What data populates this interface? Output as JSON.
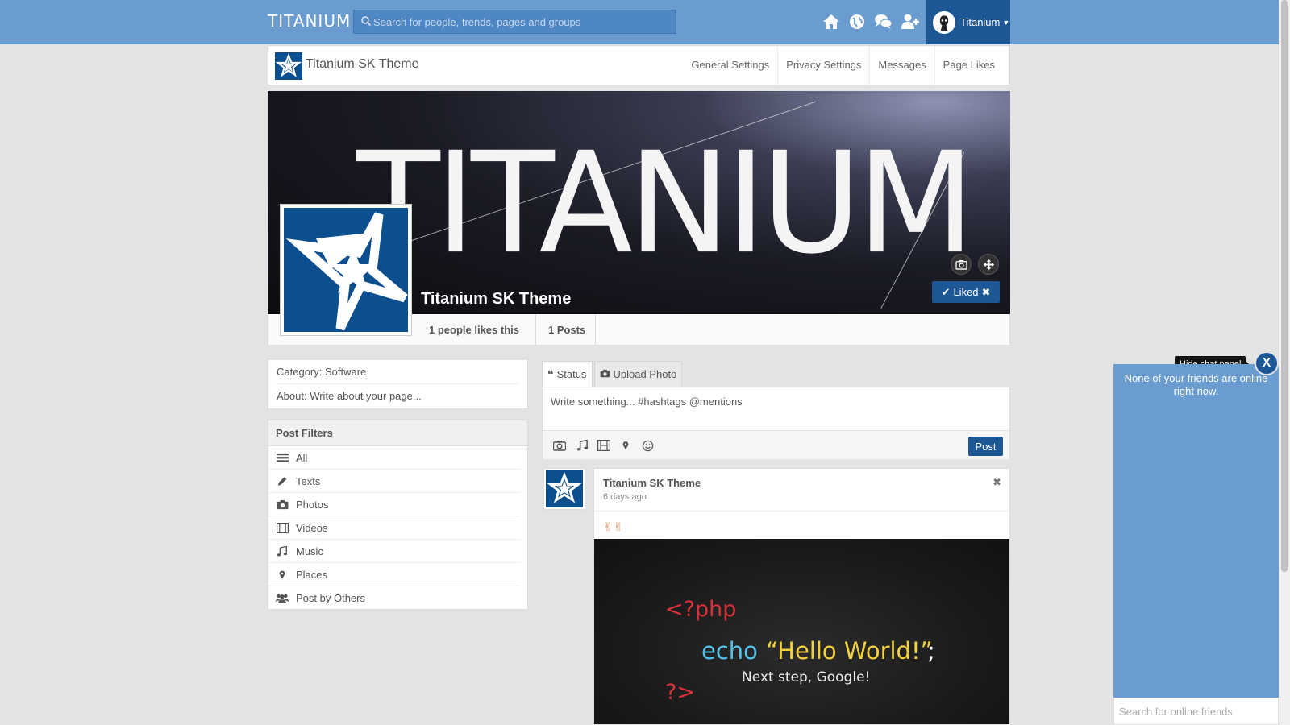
{
  "topbar": {
    "logo": "TITANIUM",
    "search_placeholder": "Search for people, trends, pages and groups",
    "icons": [
      "home-icon",
      "globe-icon",
      "messages-icon",
      "add-friend-icon"
    ],
    "user_name": "Titanium"
  },
  "page_header": {
    "title": "Titanium SK Theme",
    "nav": [
      "General Settings",
      "Privacy Settings",
      "Messages",
      "Page Likes"
    ]
  },
  "cover": {
    "cover_text": "TITANIUM",
    "page_name": "Titanium SK Theme",
    "liked_label": "Liked"
  },
  "stats": {
    "likes": "1 people likes this",
    "posts": "1 Posts"
  },
  "info": {
    "category": "Category: Software",
    "about": "About: Write about your page..."
  },
  "filters": {
    "title": "Post Filters",
    "items": [
      "All",
      "Texts",
      "Photos",
      "Videos",
      "Music",
      "Places",
      "Post by Others"
    ]
  },
  "composer": {
    "tab_status": "Status",
    "tab_upload": "Upload Photo",
    "placeholder": "Write something... #hashtags @mentions",
    "post_label": "Post"
  },
  "post": {
    "author": "Titanium SK Theme",
    "time": "6 days ago",
    "text": "✌✌",
    "code_open": "<?php",
    "code_echo": "echo",
    "code_string": "“Hello World!”",
    "code_semicolon": ";",
    "code_note": "Next step, Google!",
    "code_close": "?>"
  },
  "chat": {
    "tooltip": "Hide chat panel",
    "close": "X",
    "empty_message": "None of your friends are online right now.",
    "search_placeholder": "Search for online friends"
  },
  "colors": {
    "topbar": "#6a9ccf",
    "accent": "#1d5796",
    "brand_star_bg": "#0b4f8f"
  }
}
